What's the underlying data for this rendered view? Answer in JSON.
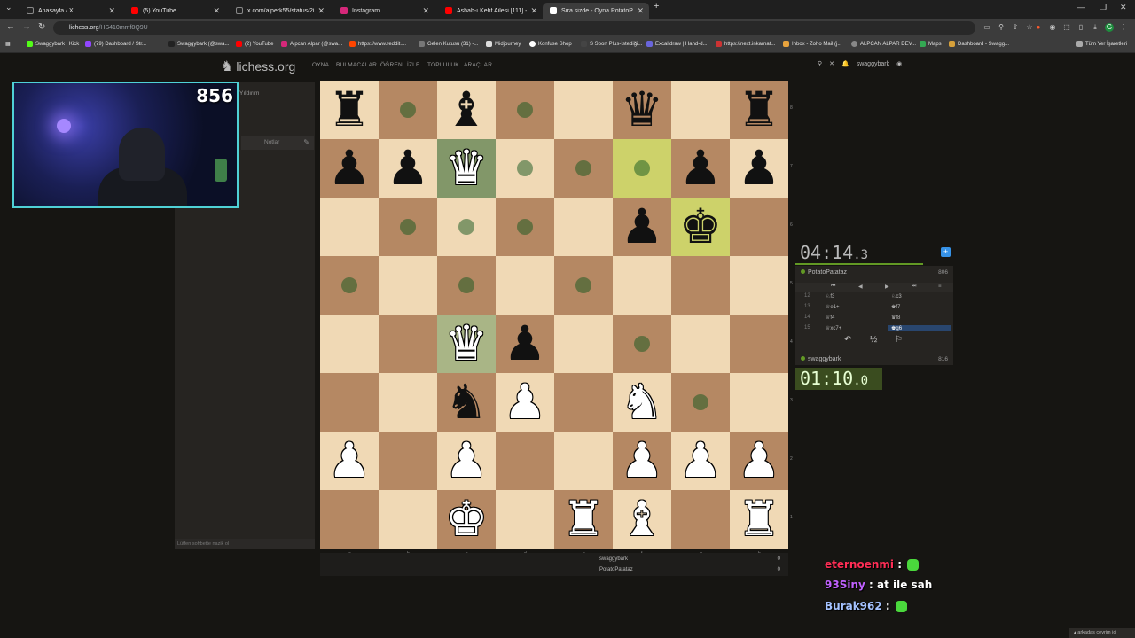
{
  "browser": {
    "tabs": [
      {
        "label": "Anasayfa / X",
        "icon": "x-icon",
        "color": "#222222"
      },
      {
        "label": "(5) YouTube",
        "icon": "youtube-icon",
        "color": "#ff0000"
      },
      {
        "label": "x.com/alperk55/status/200989...",
        "icon": "x-icon",
        "color": "#222222"
      },
      {
        "label": "Instagram",
        "icon": "instagram-icon",
        "color": "#d6287a"
      },
      {
        "label": "Ashab-ı Kehf Ailesi [111] - bayıl",
        "icon": "youtube-icon",
        "color": "#ff0000"
      },
      {
        "label": "Sıra sizde - Oyna PotatoPatataz",
        "icon": "lichess-icon",
        "color": "#ffffff"
      }
    ],
    "url_host": "lichess.org",
    "url_path": "/HS410mmf8Q9U",
    "bookmarks": [
      "Swaggybark | Kick",
      "(79) Dashboard / Str...",
      "Swaggybark (@swa...",
      "(2) YouTube",
      "Alpcan Alpar (@swa...",
      "https://www.reddit....",
      "Gelen Kutusu (31) -...",
      "Midjourney",
      "Konfuse Shop",
      "S Sport Plus-İstediği...",
      "Excalidraw | Hand-d...",
      "https://next.inkarnat...",
      "Inbox - Zoho Mail (j...",
      "ALPCAN ALPAR DEV...",
      "Maps",
      "Dashboard - Swagg..."
    ],
    "all_bookmarks": "Tüm Yer İşaretleri"
  },
  "site": {
    "logo": "lichess.org",
    "nav": [
      "OYNA",
      "BULMACALAR",
      "ÖĞREN",
      "İZLE",
      "TOPLULUK",
      "ARAÇLAR"
    ],
    "username": "swaggybark"
  },
  "stream": {
    "counter": "856",
    "chat": [
      {
        "user": "eternoenmi",
        "color": "#ff2d55",
        "text": ""
      },
      {
        "user": "93Siny",
        "color": "#c061ff",
        "text": "at ile sah"
      },
      {
        "user": "Burak962",
        "color": "#a4c2ff",
        "text": ""
      }
    ]
  },
  "left_panel": {
    "speed": "Yıldırım",
    "notes": "Notlar",
    "chat_placeholder": "Lütfen sohbette nazik ol"
  },
  "board": {
    "files": [
      "a",
      "b",
      "c",
      "d",
      "e",
      "f",
      "g",
      "h"
    ],
    "ranks": [
      "8",
      "7",
      "6",
      "5",
      "4",
      "3",
      "2",
      "1"
    ],
    "pieces": {
      "a8": "bR",
      "c8": "bB",
      "f8": "bQ",
      "h8": "bR",
      "a7": "bP",
      "b7": "bP",
      "c7": "wQ",
      "g7": "bP",
      "h7": "bP",
      "f6": "bP",
      "g6": "bK",
      "c4": "wQ",
      "d4": "bP",
      "c3": "bN",
      "d3": "wP",
      "f3": "wN",
      "a2": "wP",
      "c2": "wP",
      "f2": "wP",
      "g2": "wP",
      "h2": "wP",
      "c1": "wK",
      "e1": "wR",
      "f1": "wB",
      "h1": "wR"
    },
    "highlight": [
      "f7",
      "g6"
    ],
    "selected": [
      "c7",
      "c4"
    ],
    "dots": [
      "b8",
      "d8",
      "c7",
      "d7",
      "e7",
      "f7",
      "b6",
      "c6",
      "d6",
      "a5",
      "c5",
      "e5",
      "f4",
      "g3"
    ]
  },
  "underboard": {
    "rows": [
      {
        "name": "swaggybark",
        "score": "0"
      },
      {
        "name": "PotatoPatataz",
        "score": "0"
      }
    ]
  },
  "game": {
    "opponent": {
      "name": "PotatoPatataz",
      "rating": "806",
      "clock_main": "04:14",
      "clock_tenths": ".3"
    },
    "player": {
      "name": "swaggybark",
      "rating": "816",
      "clock_main": "01:10",
      "clock_tenths": ".0"
    },
    "moves": [
      {
        "num": "12",
        "white": "♘f3",
        "black": "♘c3"
      },
      {
        "num": "13",
        "white": "♕e1+",
        "black": "♚f7"
      },
      {
        "num": "14",
        "white": "♕f4",
        "black": "♛f8"
      },
      {
        "num": "15",
        "white": "♕xc7+",
        "black": "♚g6"
      }
    ],
    "draw_symbol": "½"
  },
  "friends_label": "arkadaş çevrim içi"
}
